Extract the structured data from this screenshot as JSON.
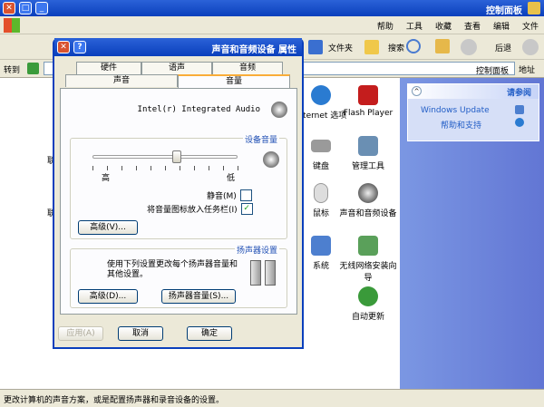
{
  "window": {
    "title": "控制面板",
    "address_label": "地址",
    "address_value": "控制面板",
    "go": "转到"
  },
  "menu": [
    "文件",
    "编辑",
    "查看",
    "收藏",
    "工具",
    "帮助"
  ],
  "toolbar": {
    "back": "后退",
    "search": "搜索",
    "folders": "文件夹"
  },
  "side": {
    "header": "请参阅",
    "links": [
      "Windows Update",
      "帮助和支持"
    ]
  },
  "main_icons": [
    {
      "label": "Flash Player",
      "icon": "flash-icon",
      "color": "#c41d1d"
    },
    {
      "label": "Internet 选项",
      "icon": "globe-icon",
      "color": "#2a7bd1"
    },
    {
      "label": "管理工具",
      "icon": "admin-tools-icon",
      "color": "#6a8fb3"
    },
    {
      "label": "键盘",
      "icon": "keyboard-icon",
      "color": "#9a9a9a"
    },
    {
      "label": "声音和音频设备",
      "icon": "sound-icon",
      "color": "#7a7a7a"
    },
    {
      "label": "鼠标",
      "icon": "mouse-icon",
      "color": "#bbbbbb"
    },
    {
      "label": "无线网络安装向导",
      "icon": "wireless-icon",
      "color": "#5aa05a"
    },
    {
      "label": "系统",
      "icon": "system-icon",
      "color": "#4d7fcf"
    },
    {
      "label": "自动更新",
      "icon": "update-icon",
      "color": "#3a9a3a"
    }
  ],
  "dialog": {
    "title": "声音和音频设备 属性",
    "tabs_row1": [
      "硬件",
      "语声",
      "音频"
    ],
    "tabs_row2": [
      "声音",
      "音量"
    ],
    "device": "Intel(r) Integrated Audio",
    "device_volume_label": "设备音量",
    "low": "低",
    "high": "高",
    "volume_level": 0.42,
    "mute_label": "静音(M)",
    "mute_checked": false,
    "tray_label": "将音量图标放入任务栏(I)",
    "tray_checked": true,
    "advanced_btn": "高级(V)...",
    "speaker_group_label": "扬声器设置",
    "speaker_desc": "使用下列设置更改每个扬声器音量和其他设置。",
    "speaker_volume_btn": "扬声器音量(S)...",
    "speaker_advanced_btn": "高级(D)...",
    "ok": "确定",
    "cancel": "取消",
    "apply": "应用(A)"
  },
  "status": "更改计算机的声音方案，或是配置扬声器和录音设备的设置。"
}
